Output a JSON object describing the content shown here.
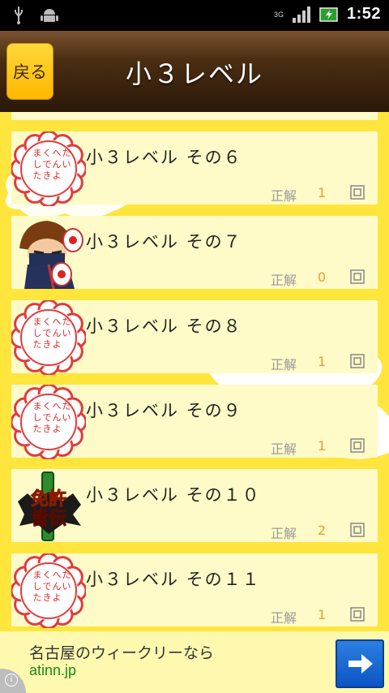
{
  "status_bar": {
    "network_type": "3G",
    "time": "1:52"
  },
  "header": {
    "back_label": "戻る",
    "title": "小３レベル"
  },
  "list": {
    "items": [
      {
        "label": "小３レベル その６",
        "correct_label": "正解",
        "count": "1",
        "badge": "stamp"
      },
      {
        "label": "小３レベル その７",
        "correct_label": "正解",
        "count": "0",
        "badge": "ninja"
      },
      {
        "label": "小３レベル その８",
        "correct_label": "正解",
        "count": "1",
        "badge": "stamp"
      },
      {
        "label": "小３レベル その９",
        "correct_label": "正解",
        "count": "1",
        "badge": "stamp"
      },
      {
        "label": "小３レベル その１０",
        "correct_label": "正解",
        "count": "2",
        "badge": "license"
      },
      {
        "label": "小３レベル その１１",
        "correct_label": "正解",
        "count": "1",
        "badge": "stamp"
      }
    ],
    "stamp_text": "たいへんよくできました",
    "license_text": [
      "免許",
      "皆伝"
    ]
  },
  "ad": {
    "line1": "名古屋のウィークリーなら",
    "line2": "atinn.jp",
    "info_glyph": "i"
  },
  "colors": {
    "background": "#ffe53c",
    "row_bg": "#fffbc8",
    "count": "#f19a2e",
    "header_dark": "#2b1808",
    "back_button": "#ffc800"
  }
}
